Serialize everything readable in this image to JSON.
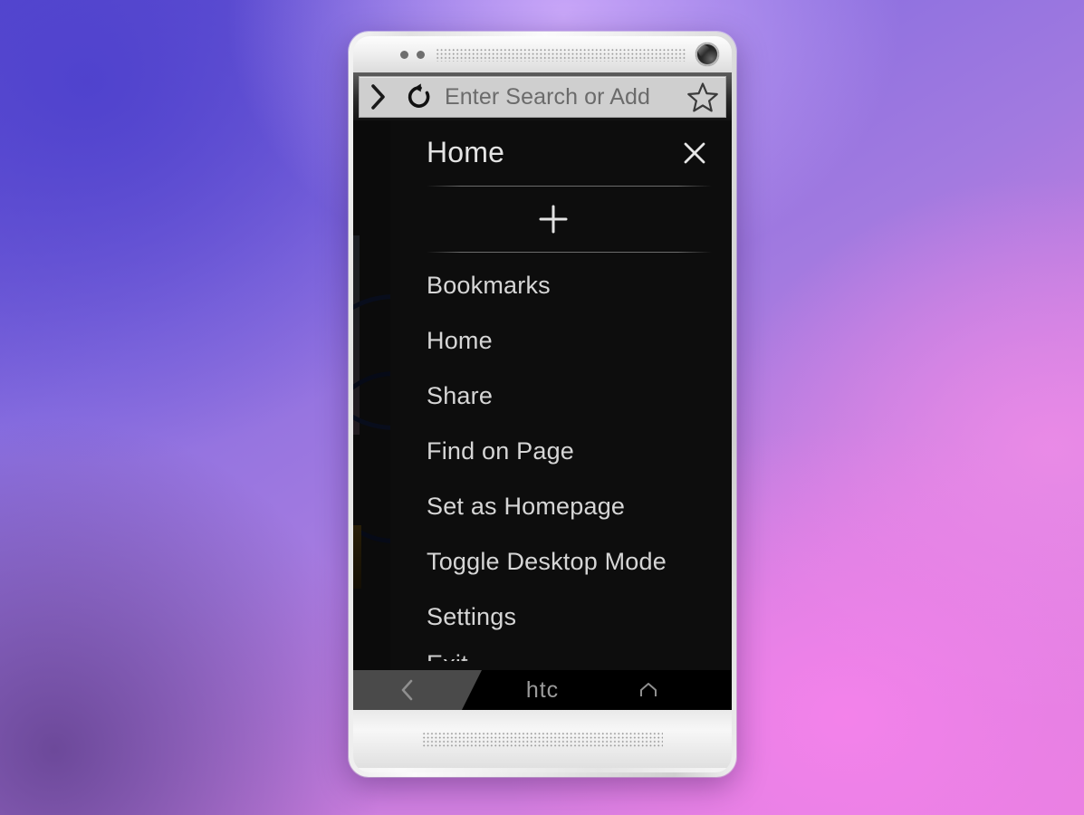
{
  "device": {
    "brand_logo": "htc",
    "icons": {
      "earpiece": "speaker-grille",
      "front_camera": "front-camera",
      "sensors": "proximity-sensor-dots",
      "bottom_speaker": "speaker-grille"
    }
  },
  "browser": {
    "toolbar": {
      "forward_icon": "chevron-right-icon",
      "reload_icon": "reload-icon",
      "url_value": "Enter Search or Add",
      "url_placeholder": "Enter Search or Address",
      "bookmark_icon": "star-icon"
    }
  },
  "menu": {
    "title": "Home",
    "close_icon": "close-icon",
    "new_tab_icon": "plus-icon",
    "new_tab_label": "New Tab",
    "items": [
      {
        "label": "Bookmarks",
        "name": "menu-item-bookmarks"
      },
      {
        "label": "Home",
        "name": "menu-item-home"
      },
      {
        "label": "Share",
        "name": "menu-item-share"
      },
      {
        "label": "Find on Page",
        "name": "menu-item-find-on-page"
      },
      {
        "label": "Set as Homepage",
        "name": "menu-item-set-as-homepage"
      },
      {
        "label": "Toggle Desktop Mode",
        "name": "menu-item-toggle-desktop-mode"
      },
      {
        "label": "Settings",
        "name": "menu-item-settings"
      },
      {
        "label": "Exit",
        "name": "menu-item-exit"
      }
    ]
  },
  "navbar": {
    "back_icon": "chevron-left-icon",
    "home_icon": "home-icon",
    "logo": "htc"
  },
  "colors": {
    "menu_background": "#0d0d0d",
    "menu_text": "#d6d6d6",
    "toolbar_background": "#cfcfcf",
    "toolbar_text": "#6b6b6b",
    "navbar_background": "#000000",
    "navbar_back_highlight": "#4a4a4a",
    "wallpaper_start": "#5a4bd0",
    "wallpaper_end": "#e77fe0"
  }
}
